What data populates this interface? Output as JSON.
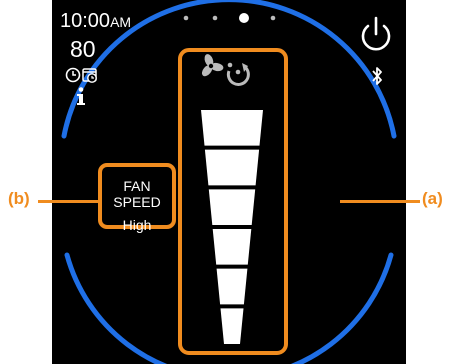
{
  "status": {
    "time": "10:00",
    "ampm": "AM",
    "temperature": "80",
    "schedule_icons": [
      "clock-icon",
      "calendar-clock-icon"
    ],
    "info_icon": "info-icon"
  },
  "pager": {
    "count": 4,
    "active_index": 2
  },
  "fan_speed": {
    "label": "FAN SPEED",
    "value": "High",
    "mode_icon": "fan-rotate-icon",
    "bar_levels": 6,
    "level": 6
  },
  "controls": {
    "power_icon": "power-icon",
    "bluetooth_icon": "bluetooth-icon"
  },
  "callouts": {
    "a": "(a)",
    "b": "(b)"
  },
  "colors": {
    "accent_ring": "#1f6fe6",
    "callout": "#f08c1f",
    "bar": "#ffffff",
    "icon": "#bbbbbb"
  }
}
